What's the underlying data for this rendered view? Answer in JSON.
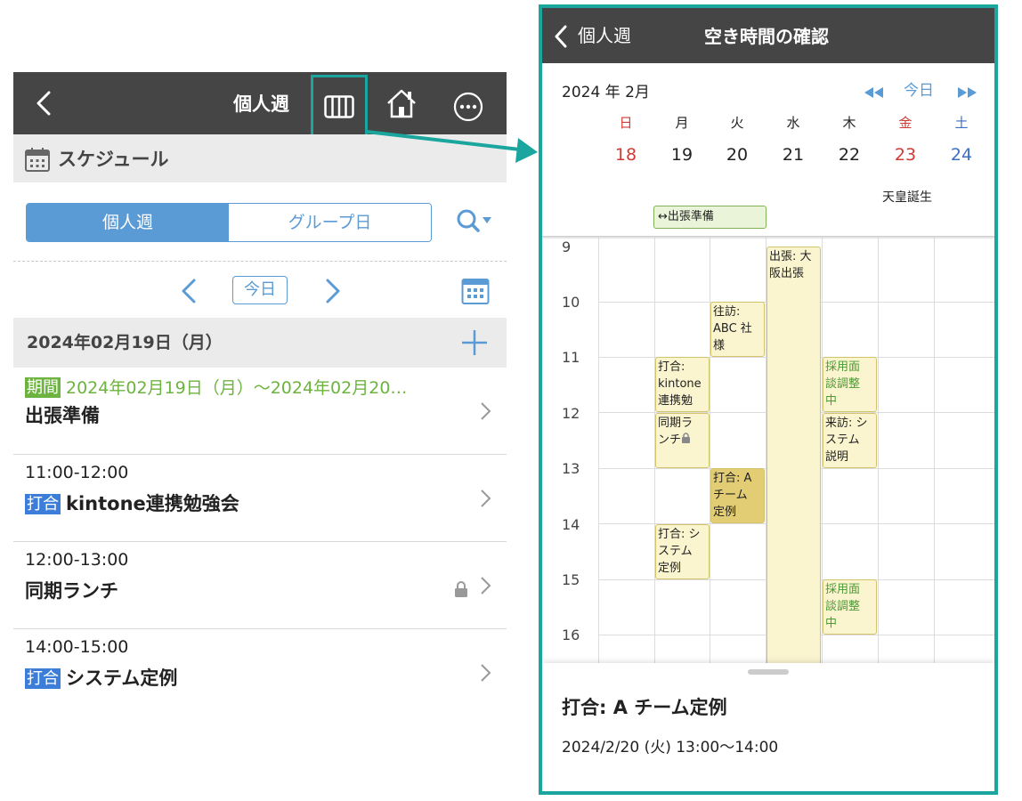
{
  "left": {
    "nav": {
      "title": "個人週"
    },
    "section": {
      "label": "スケジュール"
    },
    "segments": [
      {
        "label": "個人週"
      },
      {
        "label": "グループ日"
      }
    ],
    "date_nav": {
      "today": "今日"
    },
    "date_header": "2024年02月19日（月）",
    "events": [
      {
        "time": "2024年02月19日（月）～2024年02月20…",
        "badge": "期間",
        "title": "出張準備"
      },
      {
        "time": "11:00-12:00",
        "badge": "打合",
        "title": "kintone連携勉強会"
      },
      {
        "time": "12:00-13:00",
        "badge": "",
        "title": "同期ランチ"
      },
      {
        "time": "14:00-15:00",
        "badge": "打合",
        "title": "システム定例"
      }
    ]
  },
  "right": {
    "nav": {
      "back_label": "個人週",
      "title": "空き時間の確認"
    },
    "month": "2024 年 2月",
    "today": "今日",
    "weekdays": [
      "日",
      "月",
      "火",
      "水",
      "木",
      "金",
      "土"
    ],
    "dates": [
      "18",
      "19",
      "20",
      "21",
      "22",
      "23",
      "24"
    ],
    "holiday": "天皇誕生",
    "multi_day": "↔出張準備",
    "hours": [
      "9",
      "10",
      "11",
      "12",
      "13",
      "14",
      "15",
      "16"
    ],
    "events": [
      {
        "text": "出張: 大\n阪出張"
      },
      {
        "text": "往訪:\nABC 社\n様"
      },
      {
        "text": "打合:\nkintone\n連携勉"
      },
      {
        "text": "採用面\n談調整\n中"
      },
      {
        "text": "同期ラ\nンチ"
      },
      {
        "text": "来訪: シ\nステム\n説明"
      },
      {
        "text": "打合: A\nチーム\n定例"
      },
      {
        "text": "打合: シ\nステム\n定例"
      },
      {
        "text": "採用面\n談調整\n中"
      }
    ],
    "detail": {
      "title": "打合: A チーム定例",
      "time": "2024/2/20 (火) 13:00〜14:00"
    }
  },
  "colors": {
    "accent_teal": "#1aa59e",
    "nav_dark": "#454545",
    "primary_blue": "#5b9bd5",
    "badge_blue": "#3b7dd8",
    "period_green": "#6db33f",
    "event_yellow": "#fbf5cf"
  }
}
